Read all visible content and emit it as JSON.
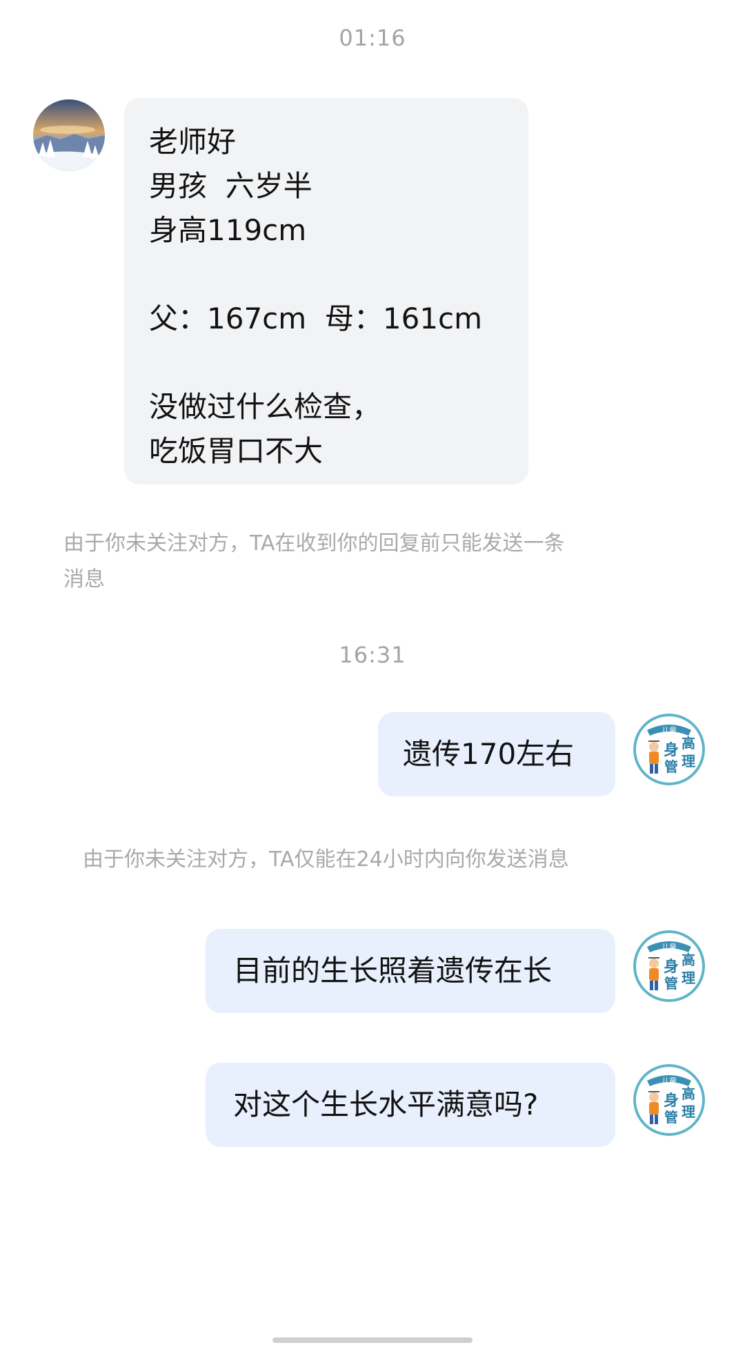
{
  "conversation": {
    "timestamp_1": "01:16",
    "timestamp_2": "16:31",
    "incoming_message": {
      "lines": [
        "老师好",
        "男孩  六岁半",
        "身高119cm",
        "",
        "父：167cm  母：161cm",
        "",
        "没做过什么检查，",
        "吃饭胃口不大"
      ]
    },
    "notice_1": {
      "line1": "由于你未关注对方，TA在收到你的回复前只能发送一条",
      "line2": "消息"
    },
    "reply_1": "遗传170左右",
    "notice_2": "由于你未关注对方，TA仅能在24小时内向你发送消息",
    "reply_2": "目前的生长照着遗传在长",
    "reply_3": "对这个生长水平满意吗?"
  },
  "brand_avatar": {
    "top_text": "儿童",
    "chars": [
      "身",
      "高",
      "管",
      "理"
    ],
    "accent_color": "#3b8fb2",
    "ring_color": "#5fb4c8"
  },
  "colors": {
    "incoming_bubble": "#f2f3f5",
    "outgoing_bubble": "#e8f0fd",
    "timestamp_text": "#a3a3a3",
    "notice_text": "#a9a9a9"
  }
}
